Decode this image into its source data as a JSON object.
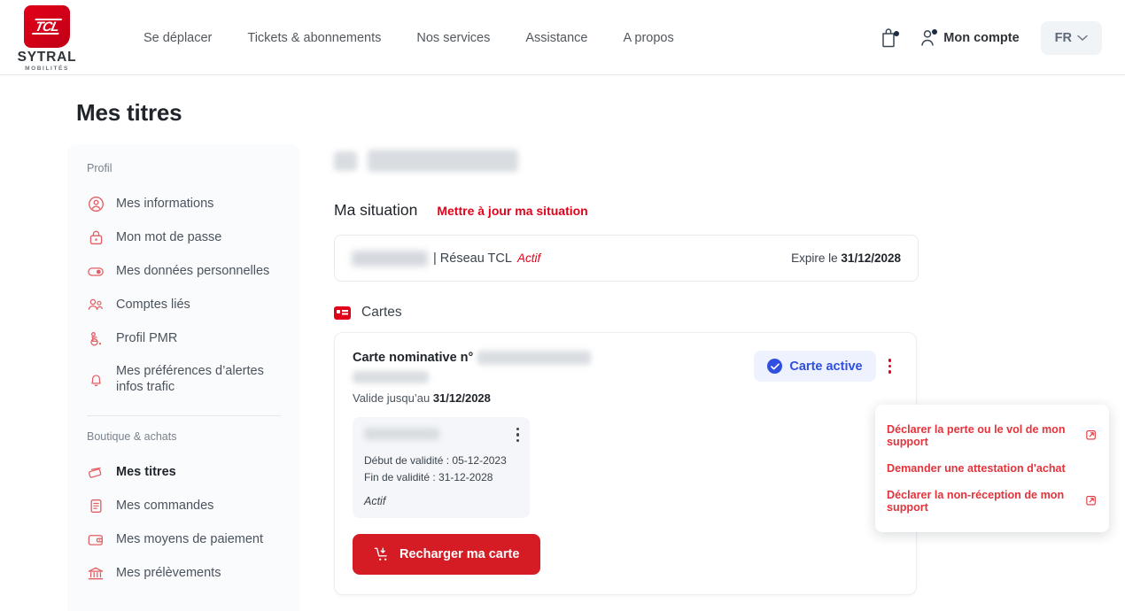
{
  "header": {
    "logo": {
      "mark_text": "TCL",
      "name": "SYTRAL",
      "sub": "MOBILITÉS"
    },
    "nav": [
      {
        "label": "Se déplacer"
      },
      {
        "label": "Tickets & abonnements"
      },
      {
        "label": "Nos services"
      },
      {
        "label": "Assistance"
      },
      {
        "label": "A propos"
      }
    ],
    "cart_icon": "shopping-bag-icon",
    "account_label": "Mon compte",
    "language": {
      "value": "FR",
      "chevron": "chevron-down-icon"
    }
  },
  "page": {
    "title": "Mes titres"
  },
  "sidebar": {
    "groups": [
      {
        "label": "Profil",
        "items": [
          {
            "label": "Mes informations",
            "icon": "user-circle-icon",
            "active": false
          },
          {
            "label": "Mon mot de passe",
            "icon": "lock-icon",
            "active": false
          },
          {
            "label": "Mes données personnelles",
            "icon": "toggle-icon",
            "active": false
          },
          {
            "label": "Comptes liés",
            "icon": "users-icon",
            "active": false
          },
          {
            "label": "Profil PMR",
            "icon": "accessibility-icon",
            "active": false
          },
          {
            "label": "Mes préférences d’alertes infos trafic",
            "icon": "bell-icon",
            "active": false
          }
        ]
      },
      {
        "label": "Boutique & achats",
        "items": [
          {
            "label": "Mes titres",
            "icon": "tickets-icon",
            "active": true
          },
          {
            "label": "Mes commandes",
            "icon": "document-icon",
            "active": false
          },
          {
            "label": "Mes moyens de paiement",
            "icon": "wallet-icon",
            "active": false
          },
          {
            "label": "Mes prélèvements",
            "icon": "bank-icon",
            "active": false
          }
        ]
      }
    ]
  },
  "main": {
    "user_name_redacted": true,
    "situation": {
      "title": "Ma situation",
      "update_link": "Mettre à jour ma situation",
      "network": "| Réseau TCL",
      "status": "Actif",
      "expiry_prefix": "Expire le ",
      "expiry_date": "31/12/2028"
    },
    "cartes": {
      "section_label": "Cartes",
      "card": {
        "title": "Carte nominative n°",
        "valid_prefix": "Valide jusqu’au ",
        "valid_date": "31/12/2028",
        "badge": "Carte active",
        "kebab": "more-options-icon",
        "subcard": {
          "start": "Début de validité : 05-12-2023",
          "end": "Fin de validité : 31-12-2028",
          "status": "Actif",
          "kebab": "more-options-icon"
        },
        "recharge_button": "Recharger ma carte",
        "recharge_icon": "cart-download-icon"
      }
    }
  },
  "context_menu": {
    "items": [
      {
        "label": "Déclarer la perte ou le vol de mon support",
        "external": true
      },
      {
        "label": "Demander une attestation d'achat",
        "external": false
      },
      {
        "label": "Déclarer la non-réception de mon support",
        "external": true
      }
    ]
  },
  "colors": {
    "brand_red": "#e2001a",
    "button_red": "#d51b23",
    "badge_blue": "#2f4fe0",
    "badge_bg": "#eef1fe",
    "text_dark": "#20252b",
    "text_muted": "#4a535e",
    "sidebar_bg": "#fafbfc"
  }
}
